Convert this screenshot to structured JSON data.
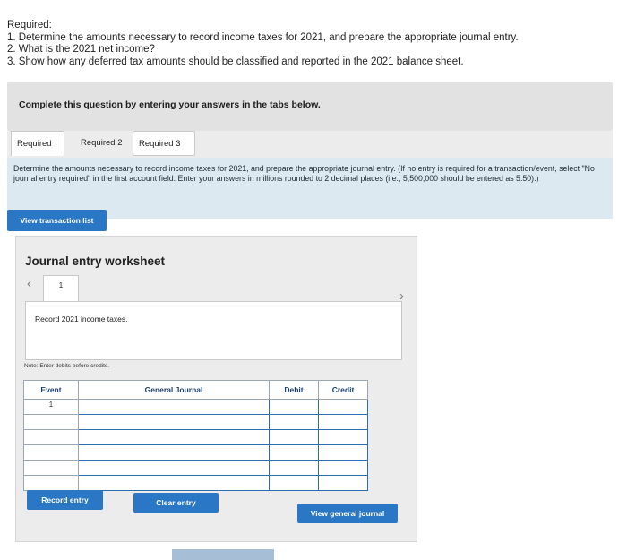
{
  "requirements": {
    "title": "Required:",
    "items": [
      "1. Determine the amounts necessary to record income taxes for 2021, and prepare the appropriate journal entry.",
      "2. What is the 2021 net income?",
      "3. Show how any deferred tax amounts should be classified and reported in the 2021 balance sheet."
    ]
  },
  "instruction": "Complete this question by entering your answers in the tabs below.",
  "tabs": [
    {
      "label": "Required 1"
    },
    {
      "label": "Required 2"
    },
    {
      "label": "Required 3"
    }
  ],
  "panel": {
    "description": "Determine the amounts necessary to record income taxes for 2021, and prepare the appropriate journal entry. (If no entry is required for a transaction/event, select \"No journal entry required\" in the first account field. Enter your answers in millions rounded to 2 decimal places (i.e., 5,500,000 should be entered as 5.50).)",
    "view_transaction_label": "View transaction list"
  },
  "worksheet": {
    "title": "Journal entry worksheet",
    "page_number": "1",
    "record_description": "Record 2021 income taxes.",
    "note": "Note: Enter debits before credits.",
    "columns": [
      "Event",
      "General Journal",
      "Debit",
      "Credit"
    ],
    "rows": [
      {
        "event": "1",
        "account": "",
        "debit": "",
        "credit": ""
      },
      {
        "event": "",
        "account": "",
        "debit": "",
        "credit": ""
      },
      {
        "event": "",
        "account": "",
        "debit": "",
        "credit": ""
      },
      {
        "event": "",
        "account": "",
        "debit": "",
        "credit": ""
      },
      {
        "event": "",
        "account": "",
        "debit": "",
        "credit": ""
      },
      {
        "event": "",
        "account": "",
        "debit": "",
        "credit": ""
      }
    ],
    "buttons": {
      "record": "Record entry",
      "clear": "Clear entry",
      "view_general_journal": "View general journal"
    }
  },
  "colors": {
    "accent": "#2a78c5",
    "panel_bg": "#dce9f1",
    "header_text": "#1c3f6b"
  }
}
